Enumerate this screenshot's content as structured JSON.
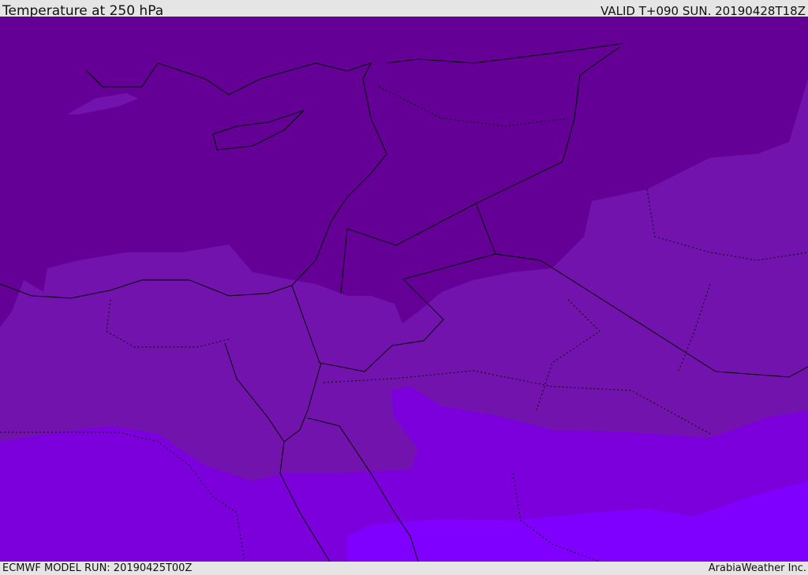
{
  "header": {
    "title": "Temperature at 250 hPa",
    "valid": "VALID T+090 SUN. 20190428T18Z"
  },
  "footer": {
    "model_run": "ECMWF MODEL RUN: 20190425T00Z",
    "brand": "ArabiaWeather Inc."
  },
  "colors": {
    "band_coldest": "#650096",
    "band_cold": "#7313ad",
    "band_mild": "#7c00dc",
    "band_warm": "#8000ff",
    "border": "#000000"
  }
}
